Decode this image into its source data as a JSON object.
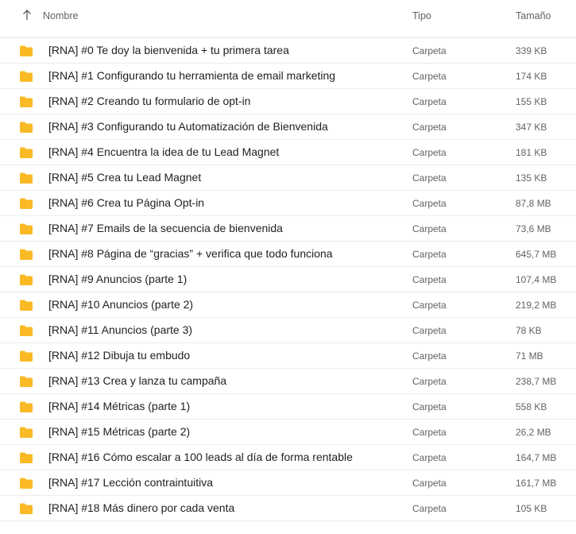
{
  "header": {
    "name_label": "Nombre",
    "type_label": "Tipo",
    "size_label": "Tamaño",
    "sort_icon": "arrow-up-icon"
  },
  "colors": {
    "folder": "#F9BA26",
    "text": "#202124",
    "muted": "#5f6368",
    "divider": "#ececec"
  },
  "rows": [
    {
      "name": "[RNA] #0 Te doy la bienvenida + tu primera tarea",
      "type": "Carpeta",
      "size": "339 KB"
    },
    {
      "name": "[RNA] #1 Configurando tu herramienta de email marketing",
      "type": "Carpeta",
      "size": "174 KB"
    },
    {
      "name": "[RNA] #2 Creando tu formulario de opt-in",
      "type": "Carpeta",
      "size": "155 KB"
    },
    {
      "name": "[RNA] #3 Configurando tu Automatización de Bienvenida",
      "type": "Carpeta",
      "size": "347 KB"
    },
    {
      "name": "[RNA] #4 Encuentra la idea de tu Lead Magnet",
      "type": "Carpeta",
      "size": "181 KB"
    },
    {
      "name": "[RNA] #5 Crea tu Lead Magnet",
      "type": "Carpeta",
      "size": "135 KB"
    },
    {
      "name": "[RNA] #6 Crea tu Página Opt-in",
      "type": "Carpeta",
      "size": "87,8 MB"
    },
    {
      "name": "[RNA] #7 Emails de la secuencia de bienvenida",
      "type": "Carpeta",
      "size": "73,6 MB"
    },
    {
      "name": "[RNA] #8 Página de “gracias” + verifica que todo funciona",
      "type": "Carpeta",
      "size": "645,7 MB"
    },
    {
      "name": "[RNA] #9 Anuncios (parte 1)",
      "type": "Carpeta",
      "size": "107,4 MB"
    },
    {
      "name": "[RNA] #10 Anuncios (parte 2)",
      "type": "Carpeta",
      "size": "219,2 MB"
    },
    {
      "name": "[RNA] #11 Anuncios (parte 3)",
      "type": "Carpeta",
      "size": "78 KB"
    },
    {
      "name": "[RNA] #12 Dibuja tu embudo",
      "type": "Carpeta",
      "size": "71 MB"
    },
    {
      "name": "[RNA] #13 Crea y lanza tu campaña",
      "type": "Carpeta",
      "size": "238,7 MB"
    },
    {
      "name": "[RNA] #14 Métricas (parte 1)",
      "type": "Carpeta",
      "size": "558 KB"
    },
    {
      "name": "[RNA] #15 Métricas (parte 2)",
      "type": "Carpeta",
      "size": "26,2 MB"
    },
    {
      "name": "[RNA] #16 Cómo escalar a 100 leads al día de forma rentable",
      "type": "Carpeta",
      "size": "164,7 MB"
    },
    {
      "name": "[RNA] #17 Lección contraintuitiva",
      "type": "Carpeta",
      "size": "161,7 MB"
    },
    {
      "name": "[RNA] #18 Más dinero por cada venta",
      "type": "Carpeta",
      "size": "105 KB"
    }
  ]
}
